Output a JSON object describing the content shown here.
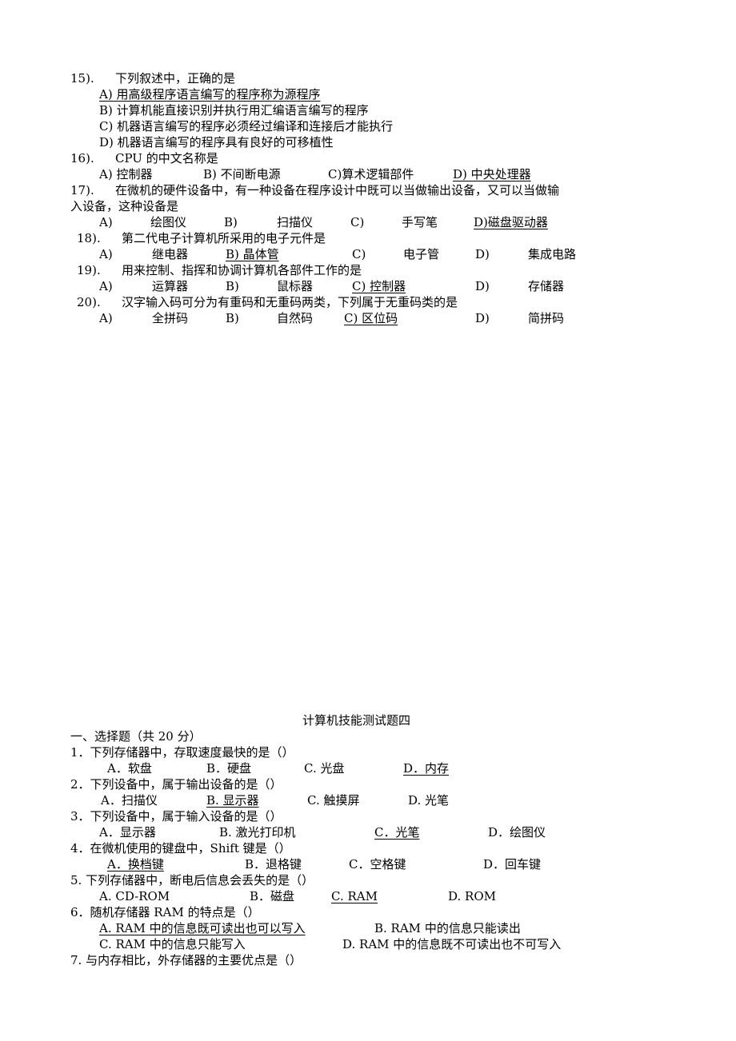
{
  "page_a": {
    "q15": {
      "num": "15).",
      "stem": "下列叙述中，正确的是",
      "options": [
        "A)      用高级程序语言编写的程序称为源程序",
        "B)      计算机能直接识别并执行用汇编语言编写的程序",
        "C)      机器语言编写的程序必须经过编译和连接后才能执行",
        "D)      机器语言编写的程序具有良好的可移植性"
      ],
      "answer_index": 0
    },
    "q16": {
      "num": "16).",
      "stem": "CPU 的中文名称是",
      "options": [
        "A)   控制器",
        "B) 不间断电源",
        "C)算术逻辑部件",
        "D)   中央处理器"
      ],
      "answer_index": 3
    },
    "q17": {
      "num": "17).",
      "stem": "在微机的硬件设备中，有一种设备在程序设计中既可以当做输出设备，又可以当做输",
      "stem_cont": "入设备，这种设备是",
      "options": [
        "A)",
        "绘图仪",
        "B)",
        "扫描仪",
        "C)",
        "手写笔",
        "D)磁盘驱动器"
      ],
      "answer_index": 3
    },
    "q18": {
      "num": "18).",
      "stem": "第二代电子计算机所采用的电子元件是",
      "options": [
        "A)",
        "继电器",
        "B)         晶体管",
        "C)",
        "电子管",
        "D)",
        "集成电路"
      ],
      "answer_index": 1
    },
    "q19": {
      "num": "19).",
      "stem": "用来控制、指挥和协调计算机各部件工作的是",
      "options": [
        "A)",
        "运算器",
        "B)",
        "鼠标器",
        "C)         控制器",
        "D)",
        "存储器"
      ],
      "answer_index": 2
    },
    "q20": {
      "num": "20).",
      "stem": "汉字输入码可分为有重码和无重码两类，下列属于无重码类的是",
      "options": [
        "A)",
        "全拼码",
        "B)",
        "自然码",
        "C)         区位码",
        "D)",
        "简拼码"
      ],
      "answer_index": 2
    }
  },
  "page_b": {
    "title": "计算机技能测试题四",
    "section": "一、选择题（共 20 分）",
    "q1": {
      "stem": "1．下列存储器中，存取速度最快的是（）",
      "options": [
        "A．软盘",
        "B．硬盘",
        "C. 光盘",
        "D．内存"
      ],
      "answer_index": 3
    },
    "q2": {
      "stem": "2．下列设备中，属于输出设备的是（）",
      "options": [
        "A．扫描仪",
        "B. 显示器",
        "C. 触摸屏",
        "D. 光笔"
      ],
      "answer_index": 1
    },
    "q3": {
      "stem": "3．下列设备中，属于输入设备的是（）",
      "options": [
        "A．显示器",
        "B. 激光打印机",
        "C．光笔",
        "D．绘图仪"
      ],
      "answer_index": 2
    },
    "q4": {
      "stem": "4．在微机使用的键盘中，Shift 键是（）",
      "options": [
        "A．换档键",
        "B．退格键",
        "C．空格键",
        "D．回车键"
      ],
      "answer_index": 0
    },
    "q5": {
      "stem": "5.     下列存储器中，断电后信息会丢失的是（）",
      "options": [
        "A. CD-ROM",
        "B．磁盘",
        "C. RAM",
        "D. ROM"
      ],
      "answer_index": 2
    },
    "q6": {
      "stem": "6．随机存储器 RAM 的特点是（）",
      "options": [
        "A. RAM 中的信息既可读出也可以写入",
        "B. RAM 中的信息只能读出",
        "C. RAM 中的信息只能写入",
        "D. RAM 中的信息既不可读出也不可写入"
      ],
      "answer_index": 0
    },
    "q7": {
      "stem": "7.    与内存相比，外存储器的主要优点是（）"
    }
  }
}
